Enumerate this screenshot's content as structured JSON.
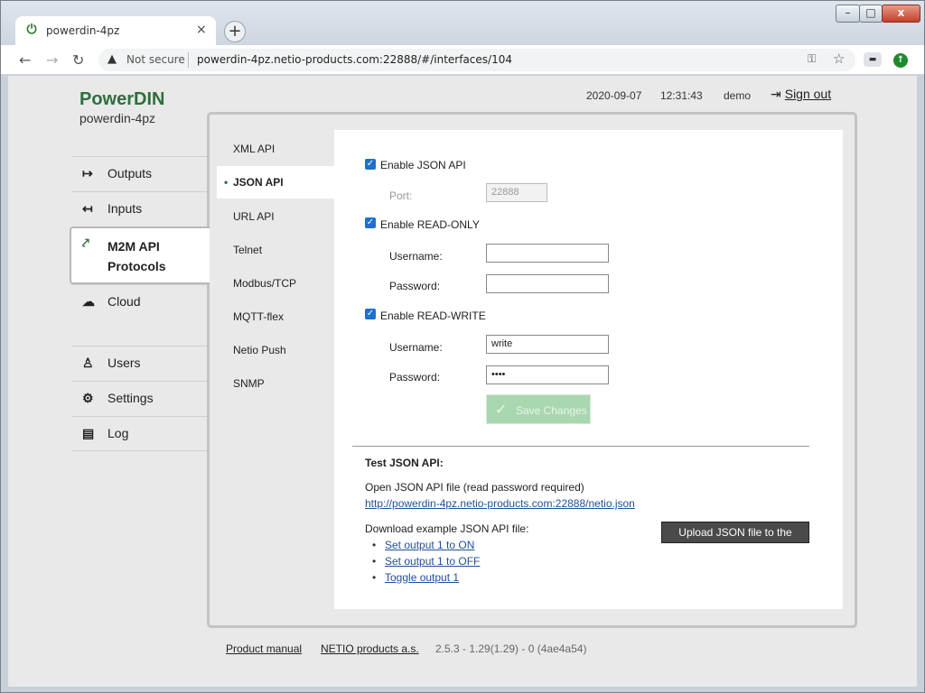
{
  "browser": {
    "tab_title": "powerdin-4pz",
    "tab_close": "×",
    "new_tab": "+",
    "not_secure": "Not secure",
    "url": "powerdin-4pz.netio-products.com:22888/#/interfaces/104"
  },
  "header": {
    "brand": "PowerDIN",
    "device": "powerdin-4pz",
    "date": "2020-09-07",
    "time": "12:31:43",
    "user": "demo",
    "signout": "Sign out"
  },
  "nav": {
    "outputs": "Outputs",
    "inputs": "Inputs",
    "m2m_line1": "M2M API",
    "m2m_line2": "Protocols",
    "cloud": "Cloud",
    "users": "Users",
    "settings": "Settings",
    "log": "Log"
  },
  "subnav": [
    "XML API",
    "JSON API",
    "URL API",
    "Telnet",
    "Modbus/TCP",
    "MQTT-flex",
    "Netio Push",
    "SNMP"
  ],
  "form": {
    "enable_json": "Enable JSON API",
    "port_label": "Port:",
    "port_value": "22888",
    "enable_ro": "Enable READ-ONLY",
    "ro_username_label": "Username:",
    "ro_username_value": "",
    "ro_password_label": "Password:",
    "ro_password_value": "",
    "enable_rw": "Enable READ-WRITE",
    "rw_username_label": "Username:",
    "rw_username_value": "write",
    "rw_password_label": "Password:",
    "rw_password_value": "••••",
    "save": "Save Changes"
  },
  "test": {
    "heading": "Test JSON API:",
    "open_text": "Open JSON API file (read password required)",
    "json_url": "http://powerdin-4pz.netio-products.com:22888/netio.json",
    "download_text": "Download example JSON API file:",
    "examples": [
      "Set output 1 to ON",
      "Set output 1 to OFF",
      "Toggle output 1"
    ],
    "upload": "Upload JSON file to the device"
  },
  "footer": {
    "manual": "Product manual",
    "company": "NETIO products a.s.",
    "version": "2.5.3 - 1.29(1.29) - 0 (4ae4a54)"
  },
  "colors": {
    "brand": "#2f6e3b",
    "checkbox": "#1e6fd0",
    "link": "#1f4f9a"
  }
}
